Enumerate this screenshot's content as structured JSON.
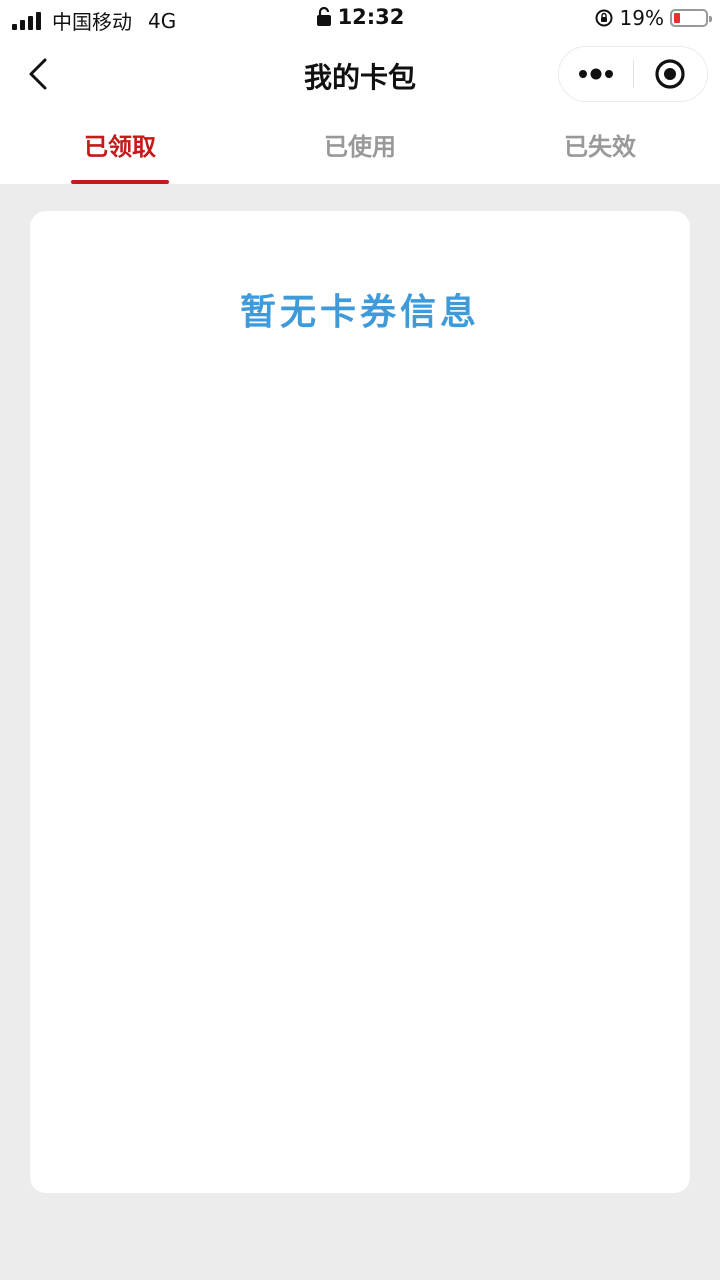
{
  "status_bar": {
    "carrier": "中国移动",
    "network": "4G",
    "time": "12:32",
    "battery_percent": "19%",
    "battery_level": 0.19,
    "battery_color": "#e5322d"
  },
  "nav": {
    "title": "我的卡包"
  },
  "tabs": [
    {
      "label": "已领取",
      "active": true
    },
    {
      "label": "已使用",
      "active": false
    },
    {
      "label": "已失效",
      "active": false
    }
  ],
  "content": {
    "empty_message": "暂无卡券信息"
  },
  "colors": {
    "accent": "#c41a1a",
    "empty_text": "#3e9ad9",
    "background": "#ececec"
  },
  "icons": {
    "back": "chevron-left-icon",
    "more": "more-dots-icon",
    "close": "target-close-icon",
    "lock": "lock-icon",
    "rotation_lock": "rotation-lock-icon"
  }
}
